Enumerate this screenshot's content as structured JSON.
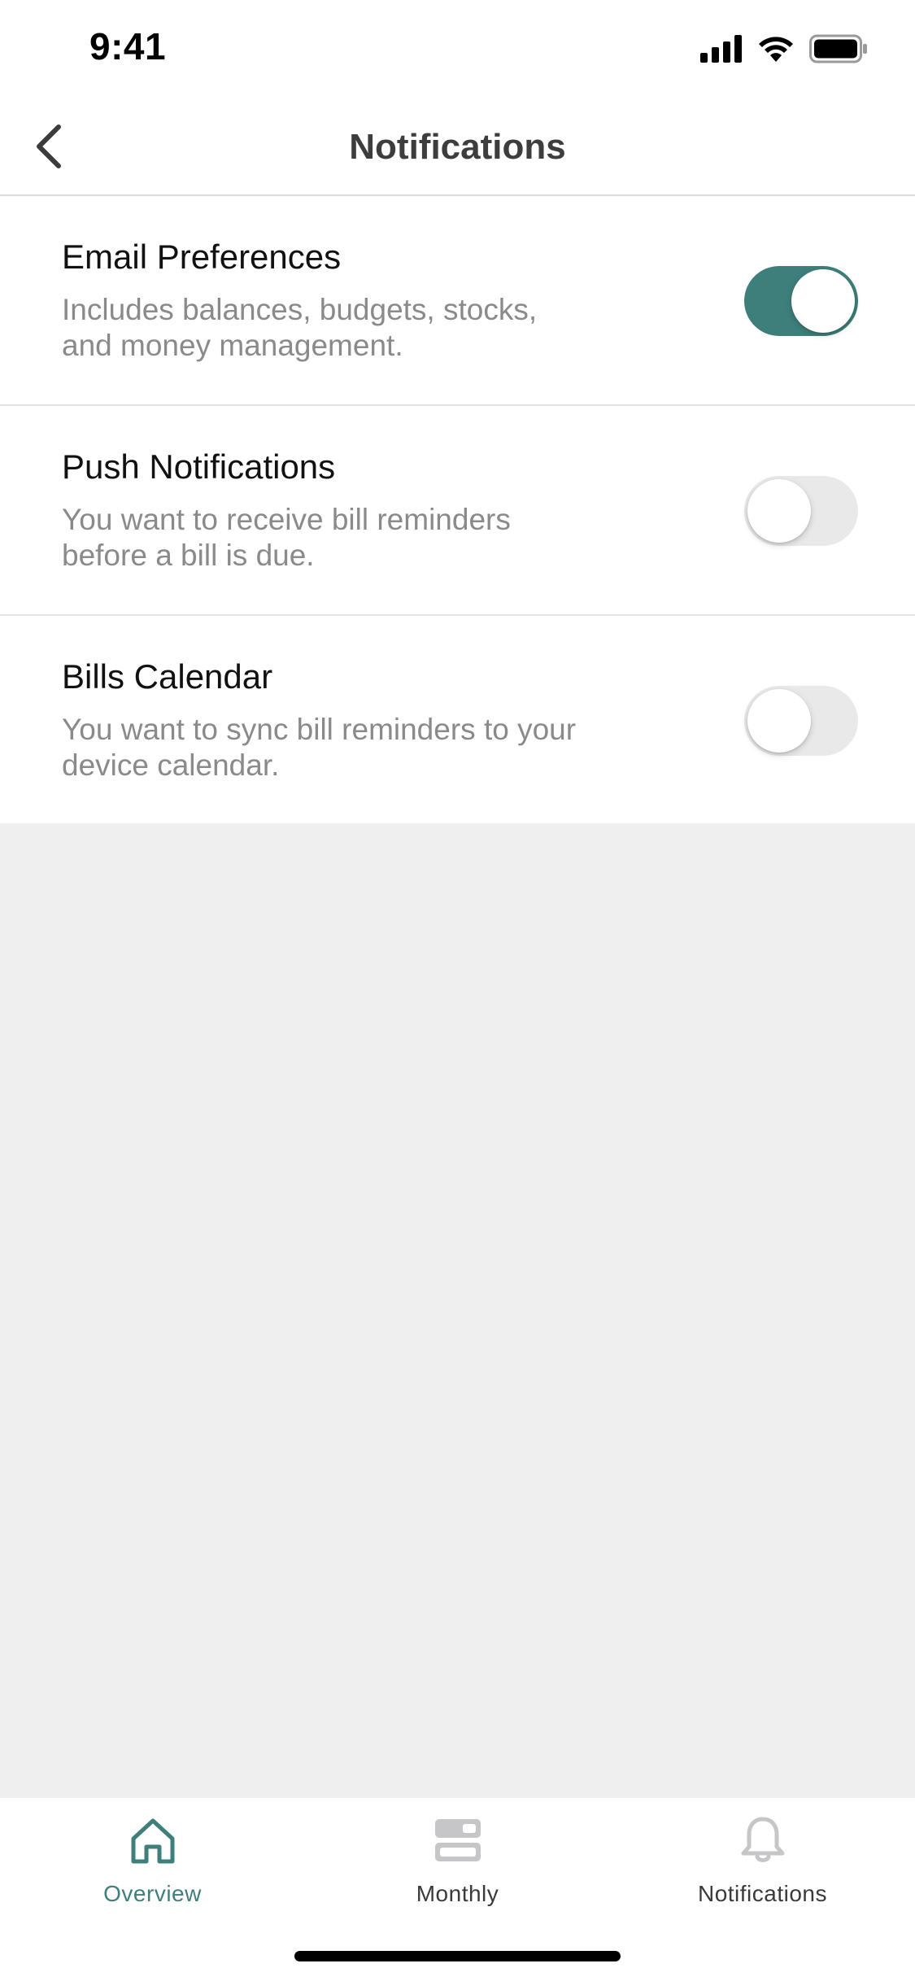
{
  "status_bar": {
    "time": "9:41"
  },
  "nav": {
    "title": "Notifications"
  },
  "settings": [
    {
      "title": "Email Preferences",
      "description": "Includes balances, budgets, stocks, and money management.",
      "enabled": true
    },
    {
      "title": "Push Notifications",
      "description": "You want to receive bill reminders before a bill is due.",
      "enabled": false
    },
    {
      "title": "Bills Calendar",
      "description": "You want to sync bill reminders to your device calendar.",
      "enabled": false
    }
  ],
  "tabs": [
    {
      "label": "Overview",
      "icon": "home-icon",
      "active": true
    },
    {
      "label": "Monthly",
      "icon": "monthly-icon",
      "active": false
    },
    {
      "label": "Notifications",
      "icon": "bell-icon",
      "active": false
    }
  ],
  "colors": {
    "accent": "#3e7f7b",
    "toggle_off": "#e9e9ea",
    "background": "#efefef"
  }
}
